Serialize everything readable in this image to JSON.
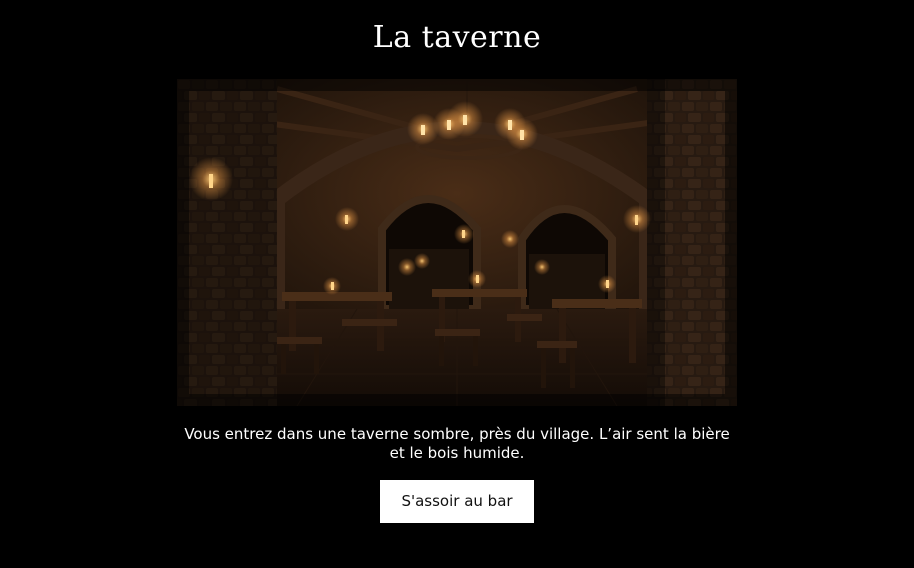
{
  "scene": {
    "title": "La taverne",
    "narration": "Vous entrez dans une taverne sombre, près du village. L’air sent la bière et le bois humide.",
    "choice_label": "S'assoir au bar"
  },
  "colors": {
    "background": "#000000",
    "text": "#ffffff",
    "button_background": "#ffffff",
    "button_text": "#111111",
    "candle_glow": "#f3a04a"
  }
}
